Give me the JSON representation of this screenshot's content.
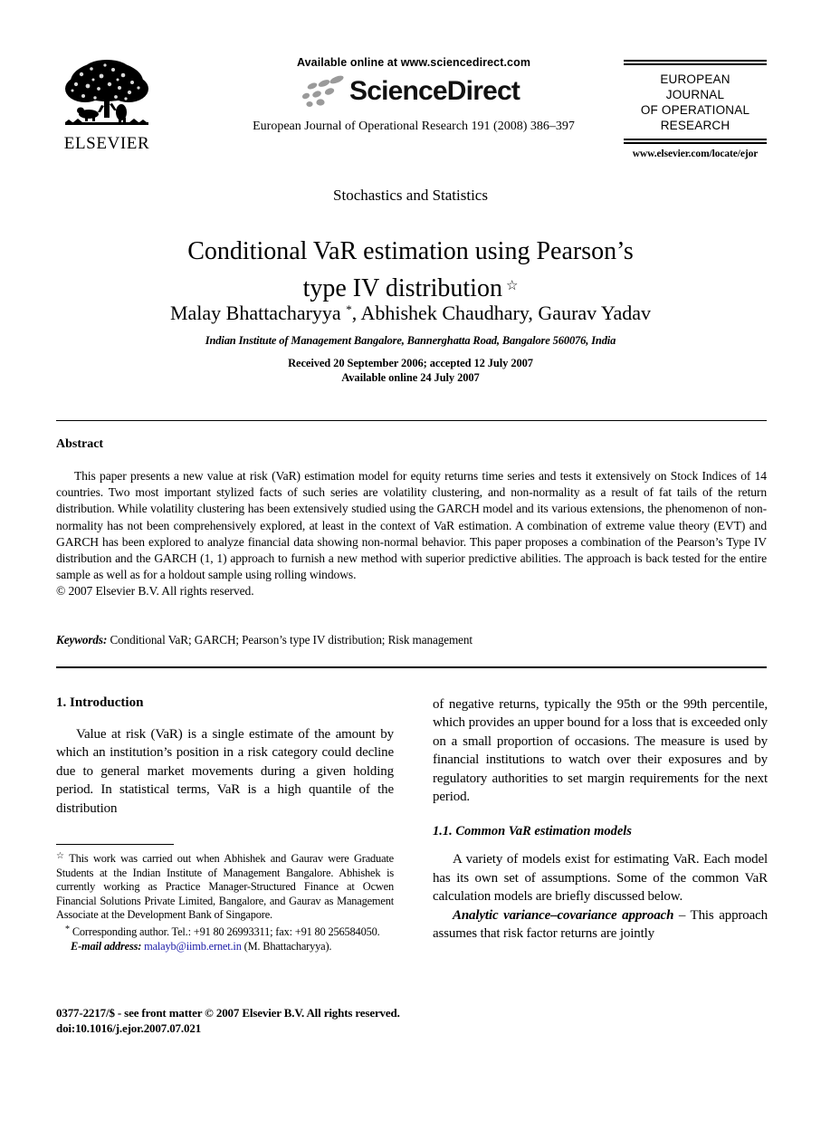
{
  "masthead": {
    "publisher_name": "ELSEVIER",
    "publisher_logo_alt": "elsevier-tree-logo",
    "available_online": "Available online at www.sciencedirect.com",
    "sciencedirect_logo_text": "ScienceDirect",
    "journal_reference": "European Journal of Operational Research 191 (2008) 386–397",
    "journal_masthead_line1": "EUROPEAN",
    "journal_masthead_line2": "JOURNAL",
    "journal_masthead_line3": "OF OPERATIONAL",
    "journal_masthead_line4": "RESEARCH",
    "journal_url": "www.elsevier.com/locate/ejor"
  },
  "article": {
    "section_label": "Stochastics and Statistics",
    "title_line1": "Conditional VaR estimation using Pearson’s",
    "title_line2": "type IV distribution",
    "title_footnote_mark": "☆",
    "authors": "Malay Bhattacharyya ",
    "author_corresponding_mark": "*",
    "authors_rest": ", Abhishek Chaudhary, Gaurav Yadav",
    "affiliation": "Indian Institute of Management Bangalore, Bannerghatta Road, Bangalore 560076, India",
    "received": "Received 20 September 2006; accepted 12 July 2007",
    "available_online": "Available online 24 July 2007"
  },
  "abstract": {
    "heading": "Abstract",
    "paragraph": "This paper presents a new value at risk (VaR) estimation model for equity returns time series and tests it extensively on Stock Indices of 14 countries. Two most important stylized facts of such series are volatility clustering, and non-normality as a result of fat tails of the return distribution. While volatility clustering has been extensively studied using the GARCH model and its various extensions, the phenomenon of non-normality has not been comprehensively explored, at least in the context of VaR estimation. A combination of extreme value theory (EVT) and GARCH has been explored to analyze financial data showing non-normal behavior. This paper proposes a combination of the Pearson’s Type IV distribution and the GARCH (1, 1) approach to furnish a new method with superior predictive abilities. The approach is back tested for the entire sample as well as for a holdout sample using rolling windows.",
    "copyright": "© 2007 Elsevier B.V. All rights reserved.",
    "keywords_label": "Keywords:",
    "keywords_value": "Conditional VaR; GARCH; Pearson’s type IV distribution; Risk management"
  },
  "body": {
    "section1_heading": "1. Introduction",
    "section1_par1": "Value at risk (VaR) is a single estimate of the amount by which an institution’s position in a risk category could decline due to general market movements during a given holding period. In statistical terms, VaR is a high quantile of the distribution",
    "section1_par1_cont": "of negative returns, typically the 95th or the 99th percentile, which provides an upper bound for a loss that is exceeded only on a small proportion of occasions. The measure is used by financial institutions to watch over their exposures and by regulatory authorities to set margin requirements for the next period.",
    "subsection11_heading": "1.1. Common VaR estimation models",
    "subsection11_par1": "A variety of models exist for estimating VaR. Each model has its own set of assumptions. Some of the common VaR calculation models are briefly discussed below.",
    "subsection11_par2_runin": "Analytic variance–covariance approach",
    "subsection11_par2_rest": " – This approach assumes that risk factor returns are jointly"
  },
  "footnotes": {
    "star_mark": "☆",
    "star_text": "This work was carried out when Abhishek and Gaurav were Graduate Students at the Indian Institute of Management Bangalore. Abhishek is currently working as Practice Manager-Structured Finance at Ocwen Financial Solutions Private Limited, Bangalore, and Gaurav as Management Associate at the Development Bank of Singapore.",
    "corresponding_mark": "*",
    "corresponding_text": "Corresponding author. Tel.: +91 80 26993311; fax: +91 80 256584050.",
    "email_label": "E-mail address:",
    "email_value": "malayb@iimb.ernet.in",
    "email_owner": "(M. Bhattacharyya)."
  },
  "imprint": {
    "issn_line": "0377-2217/$ - see front matter © 2007 Elsevier B.V. All rights reserved.",
    "doi_line": "doi:10.1016/j.ejor.2007.07.021"
  },
  "colors": {
    "text": "#000000",
    "link": "#1a1aa6",
    "sciencedirect_dots": "#9a9a9a"
  }
}
